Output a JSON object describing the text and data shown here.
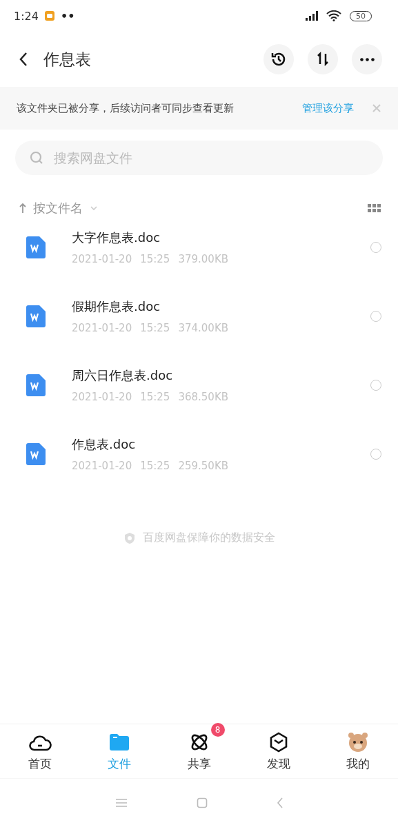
{
  "status_bar": {
    "time": "1:24",
    "dots": "••",
    "battery": "50"
  },
  "header": {
    "title": "作息表"
  },
  "share_banner": {
    "message": "该文件夹已被分享，后续访问者可同步查看更新",
    "action": "管理该分享"
  },
  "search": {
    "placeholder": "搜索网盘文件"
  },
  "sort": {
    "label": "按文件名"
  },
  "files": [
    {
      "name": "大字作息表.doc",
      "date": "2021-01-20",
      "time": "15:25",
      "size": "379.00KB",
      "selected": false
    },
    {
      "name": "假期作息表.doc",
      "date": "2021-01-20",
      "time": "15:25",
      "size": "374.00KB",
      "selected": false
    },
    {
      "name": "周六日作息表.doc",
      "date": "2021-01-20",
      "time": "15:25",
      "size": "368.50KB",
      "selected": false
    },
    {
      "name": "作息表.doc",
      "date": "2021-01-20",
      "time": "15:25",
      "size": "259.50KB",
      "selected": false
    }
  ],
  "footer_note": "百度网盘保障你的数据安全",
  "tabs": [
    {
      "kind": "home",
      "label": "首页",
      "selected": false
    },
    {
      "kind": "files",
      "label": "文件",
      "selected": true
    },
    {
      "kind": "share",
      "label": "共享",
      "selected": false,
      "badge": "8"
    },
    {
      "kind": "discover",
      "label": "发现",
      "selected": false
    },
    {
      "kind": "me",
      "label": "我的",
      "selected": false
    }
  ]
}
